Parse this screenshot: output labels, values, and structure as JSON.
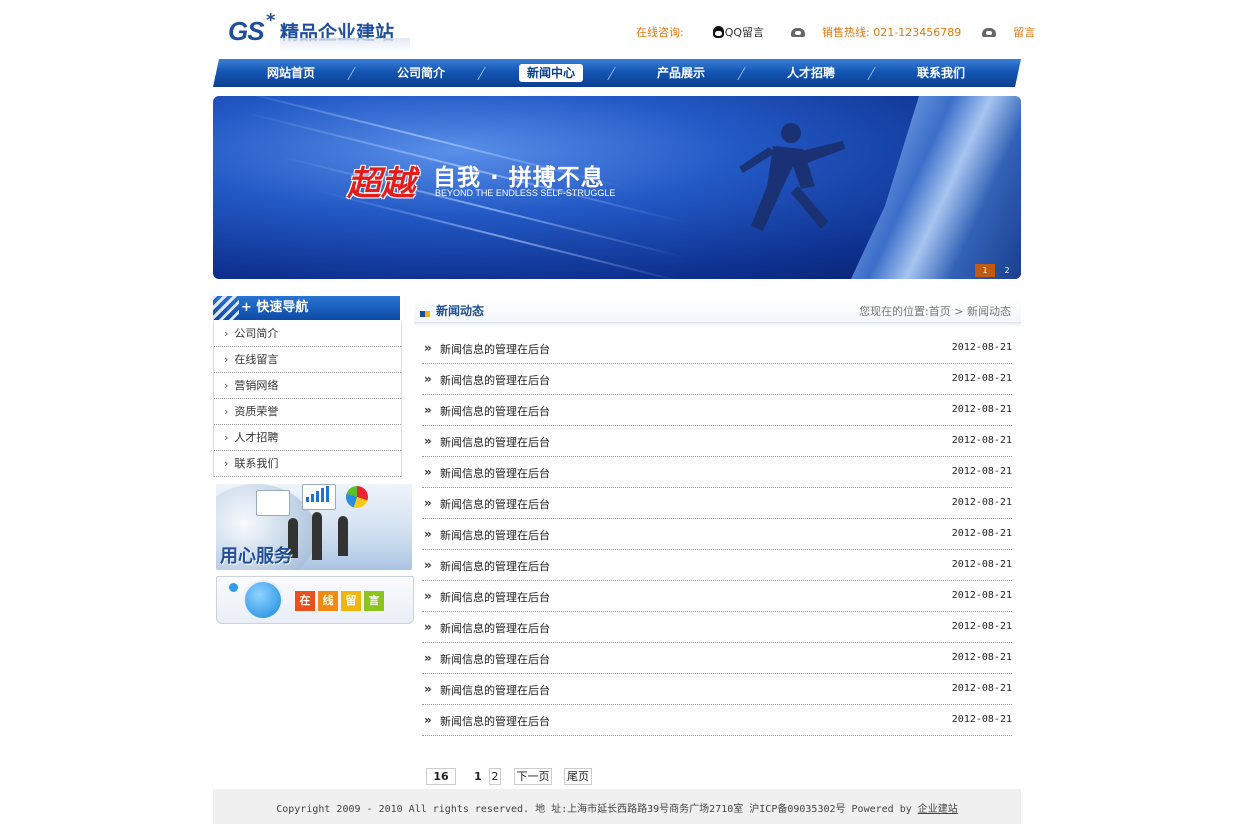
{
  "header": {
    "logo_gs": "GS",
    "logo_star": "*",
    "logo_name": "精品企业建站",
    "online_label": "在线咨询:",
    "qq_label": "QQ留言",
    "hotline_label": "销售热线:",
    "hotline_number": "021-123456789",
    "message_label": "留言"
  },
  "nav": {
    "items": [
      "网站首页",
      "公司简介",
      "新闻中心",
      "产品展示",
      "人才招聘",
      "联系我们"
    ],
    "active_index": 2
  },
  "banner": {
    "slogan_red": "超越",
    "slogan_white": "自我 · 拼搏不息",
    "slogan_en": "BEYOND THE ENDLESS SELF-STRUGGLE",
    "slides": [
      "1",
      "2"
    ],
    "active_slide": 0
  },
  "sidebar": {
    "title": "+ 快速导航",
    "items": [
      "公司简介",
      "在线留言",
      "营销网络",
      "资质荣誉",
      "人才招聘",
      "联系我们"
    ],
    "promo1_text": "用心服务",
    "promo2_chars": [
      "在",
      "线",
      "留",
      "言"
    ],
    "promo2_colors": [
      "#e8501c",
      "#f08a10",
      "#f2b50d",
      "#8cc31c"
    ]
  },
  "main": {
    "title": "新闻动态",
    "breadcrumb_prefix": "您现在的位置:",
    "breadcrumb_home": "首页",
    "breadcrumb_sep": ">",
    "breadcrumb_current": "新闻动态",
    "news": [
      {
        "title": "新闻信息的管理在后台",
        "date": "2012-08-21"
      },
      {
        "title": "新闻信息的管理在后台",
        "date": "2012-08-21"
      },
      {
        "title": "新闻信息的管理在后台",
        "date": "2012-08-21"
      },
      {
        "title": "新闻信息的管理在后台",
        "date": "2012-08-21"
      },
      {
        "title": "新闻信息的管理在后台",
        "date": "2012-08-21"
      },
      {
        "title": "新闻信息的管理在后台",
        "date": "2012-08-21"
      },
      {
        "title": "新闻信息的管理在后台",
        "date": "2012-08-21"
      },
      {
        "title": "新闻信息的管理在后台",
        "date": "2012-08-21"
      },
      {
        "title": "新闻信息的管理在后台",
        "date": "2012-08-21"
      },
      {
        "title": "新闻信息的管理在后台",
        "date": "2012-08-21"
      },
      {
        "title": "新闻信息的管理在后台",
        "date": "2012-08-21"
      },
      {
        "title": "新闻信息的管理在后台",
        "date": "2012-08-21"
      },
      {
        "title": "新闻信息的管理在后台",
        "date": "2012-08-21"
      }
    ],
    "row_icon": "»"
  },
  "pager": {
    "total": "16",
    "current": "1",
    "page2": "2",
    "next": "下一页",
    "last": "尾页"
  },
  "footer": {
    "text": "Copyright 2009 - 2010 All rights reserved. 地 址:上海市延长西路路39号商务广场2710室 沪ICP备09035302号 Powered by ",
    "link": "企业建站"
  },
  "colors": {
    "brand_blue": "#1f4f9a",
    "nav_blue": "#1456b4",
    "accent_orange": "#e3760c"
  }
}
